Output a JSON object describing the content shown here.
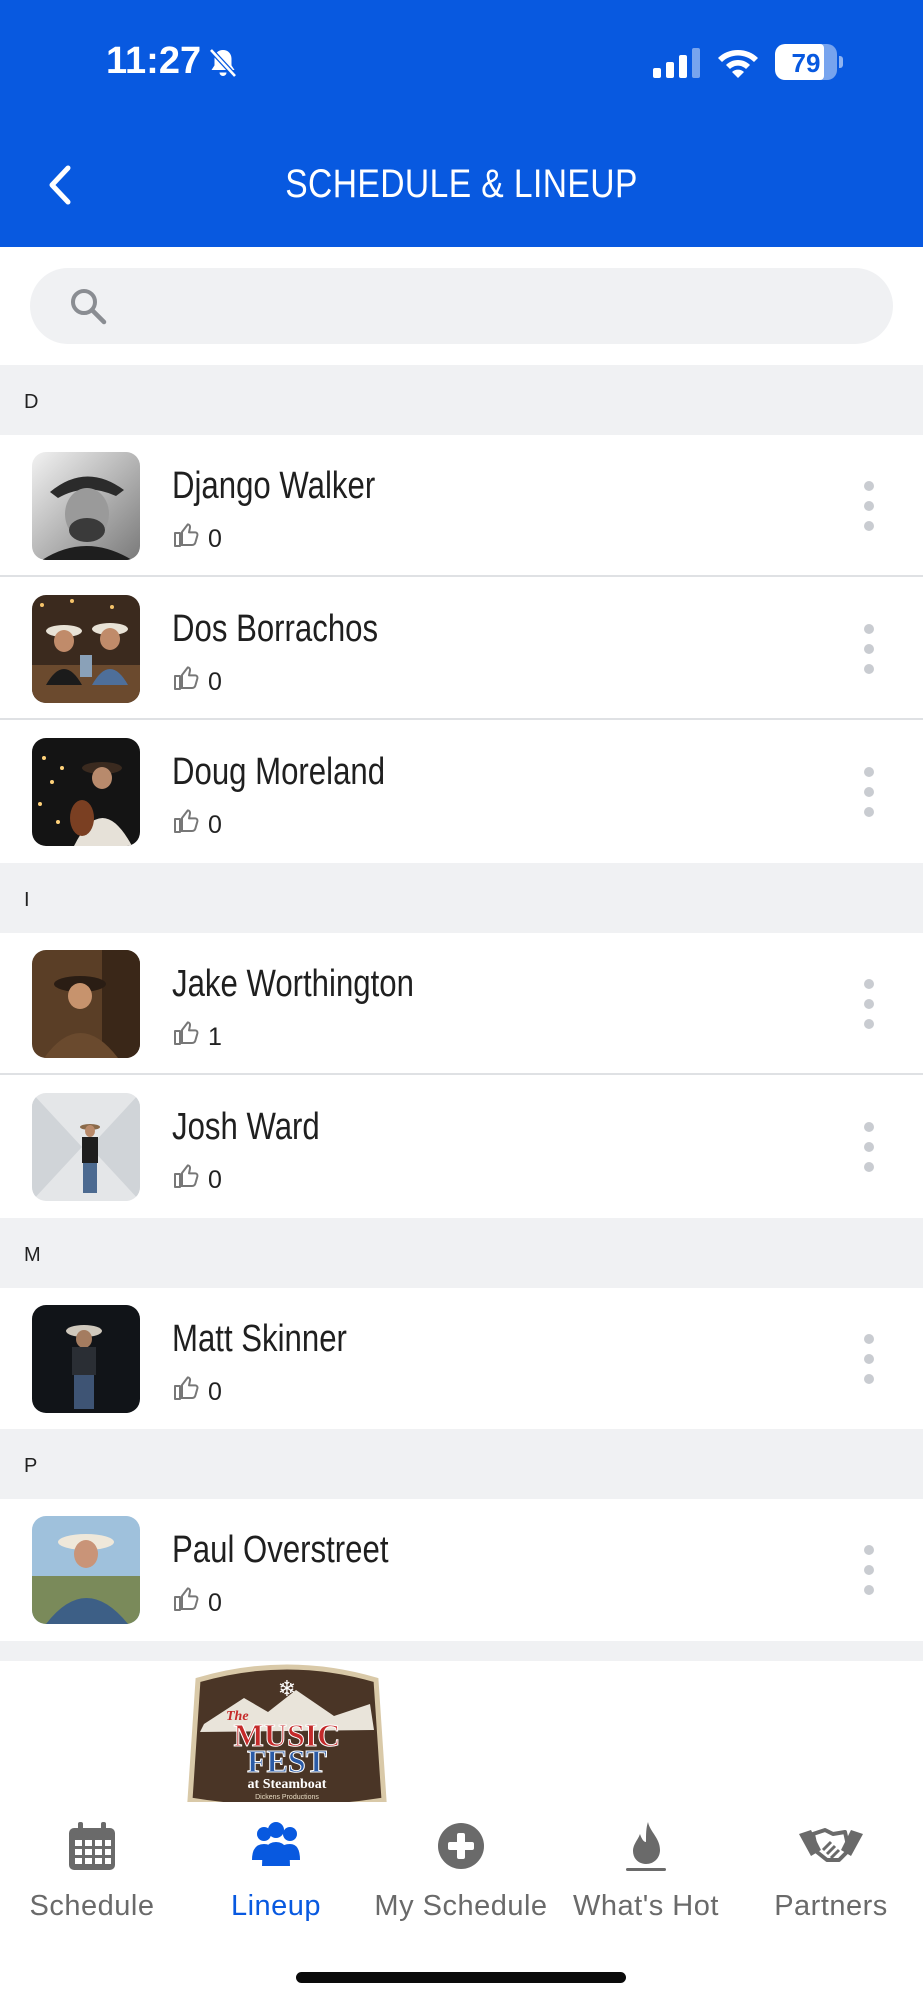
{
  "status_bar": {
    "time": "11:27",
    "battery": "79",
    "battery_level": 0.79
  },
  "header": {
    "title": "SCHEDULE & LINEUP",
    "background": "#0859e0"
  },
  "search": {
    "placeholder": "",
    "value": ""
  },
  "sections": [
    {
      "letter": "D",
      "artists": [
        {
          "name": "Django Walker",
          "likes": "0"
        },
        {
          "name": "Dos Borrachos",
          "likes": "0"
        },
        {
          "name": "Doug Moreland",
          "likes": "0"
        }
      ]
    },
    {
      "letter": "I",
      "artists": [
        {
          "name": "Jake Worthington",
          "likes": "1"
        },
        {
          "name": "Josh Ward",
          "likes": "0"
        }
      ]
    },
    {
      "letter": "M",
      "artists": [
        {
          "name": "Matt Skinner",
          "likes": "0"
        }
      ]
    },
    {
      "letter": "P",
      "artists": [
        {
          "name": "Paul Overstreet",
          "likes": "0"
        }
      ]
    }
  ],
  "logo": {
    "line1": "The",
    "line2": "MUSIC",
    "line3": "FEST",
    "line4": "at Steamboat",
    "line5": "Dickens Productions"
  },
  "tabs": [
    {
      "label": "Schedule",
      "icon": "calendar-icon",
      "active": false
    },
    {
      "label": "Lineup",
      "icon": "group-icon",
      "active": true
    },
    {
      "label": "My Schedule",
      "icon": "plus-circle-icon",
      "active": false
    },
    {
      "label": "What's Hot",
      "icon": "flame-icon",
      "active": false
    },
    {
      "label": "Partners",
      "icon": "handshake-icon",
      "active": false
    }
  ],
  "colors": {
    "accent": "#0859e0",
    "section_bg": "#f0f1f3",
    "inactive_tab": "#6a6a6a"
  }
}
